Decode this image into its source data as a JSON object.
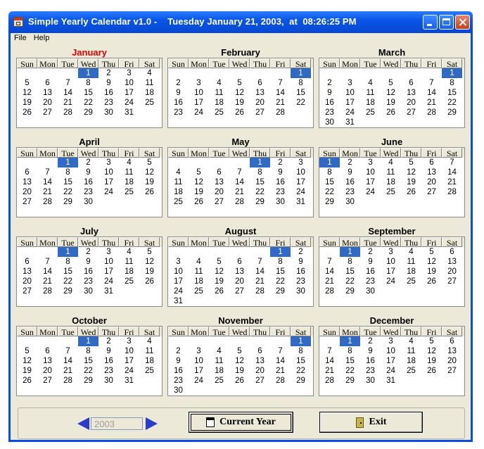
{
  "window": {
    "title": "Simple Yearly Calendar v1.0 -    Tuesday January 21, 2003,  at  08:26:25 PM"
  },
  "menu": [
    "File",
    "Help"
  ],
  "weekdays": [
    "Sun",
    "Mon",
    "Tue",
    "Wed",
    "Thu",
    "Fri",
    "Sat"
  ],
  "current_month_index": 0,
  "highlight_color": "#316ac5",
  "current_month_color": "#e00000",
  "months": [
    {
      "name": "January",
      "start": 3,
      "days": 31
    },
    {
      "name": "February",
      "start": 6,
      "days": 28
    },
    {
      "name": "March",
      "start": 6,
      "days": 31
    },
    {
      "name": "April",
      "start": 2,
      "days": 30
    },
    {
      "name": "May",
      "start": 4,
      "days": 31
    },
    {
      "name": "June",
      "start": 0,
      "days": 30
    },
    {
      "name": "July",
      "start": 2,
      "days": 31
    },
    {
      "name": "August",
      "start": 5,
      "days": 31
    },
    {
      "name": "September",
      "start": 1,
      "days": 30
    },
    {
      "name": "October",
      "start": 3,
      "days": 31
    },
    {
      "name": "November",
      "start": 6,
      "days": 30
    },
    {
      "name": "December",
      "start": 1,
      "days": 31
    }
  ],
  "controls": {
    "year_value": "2003",
    "current_year_label": "Current Year",
    "exit_label": "Exit",
    "prev_icon": "left-arrow-icon",
    "next_icon": "right-arrow-icon"
  }
}
